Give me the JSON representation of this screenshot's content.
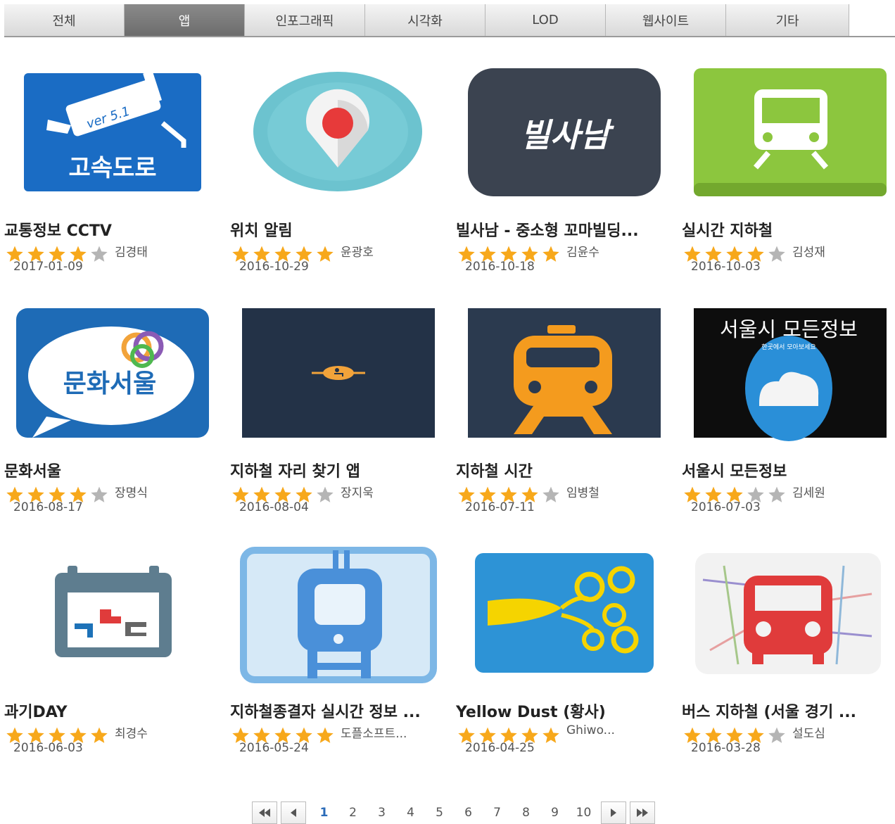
{
  "tabs": [
    "전체",
    "앱",
    "인포그래픽",
    "시각화",
    "LOD",
    "웹사이트",
    "기타"
  ],
  "active_tab": "앱",
  "icons": {
    "cctv": {
      "ver_text": "ver 5.1",
      "text": "고속도로"
    },
    "bilsanam": {
      "text": "빌사남"
    },
    "munhwa": {
      "text": "문화서울"
    },
    "seoul_info": {
      "title": "서울시 모든정보",
      "subtitle": "한곳에서 모아보세요"
    }
  },
  "apps": [
    {
      "title": "교통정보 CCTV",
      "author": "김경태",
      "date": "2017-01-09",
      "rating": 4,
      "icon": "cctv-icon"
    },
    {
      "title": "위치 알림",
      "author": "윤광호",
      "date": "2016-10-29",
      "rating": 5,
      "icon": "location-pin-icon"
    },
    {
      "title": "빌사남 - 중소형 꼬마빌딩...",
      "author": "김윤수",
      "date": "2016-10-18",
      "rating": 5,
      "icon": "bilsanam-logo-icon"
    },
    {
      "title": "실시간 지하철",
      "author": "김성재",
      "date": "2016-10-03",
      "rating": 4,
      "icon": "train-icon"
    },
    {
      "title": "문화서울",
      "author": "장명식",
      "date": "2016-08-17",
      "rating": 4,
      "icon": "culture-seoul-icon"
    },
    {
      "title": "지하철 자리 찾기 앱",
      "author": "장지욱",
      "date": "2016-08-04",
      "rating": 4,
      "icon": "seat-icon"
    },
    {
      "title": "지하철 시간",
      "author": "임병철",
      "date": "2016-07-11",
      "rating": 4,
      "icon": "orange-train-icon"
    },
    {
      "title": "서울시 모든정보",
      "author": "김세원",
      "date": "2016-07-03",
      "rating": 3,
      "icon": "cloud-info-icon"
    },
    {
      "title": "과기DAY",
      "author": "최경수",
      "date": "2016-06-03",
      "rating": 5,
      "icon": "calendar-icon"
    },
    {
      "title": "지하철종결자 실시간 정보 ...",
      "author": "도플소프트...",
      "date": "2016-05-24",
      "rating": 5,
      "icon": "subway-blue-icon"
    },
    {
      "title": "Yellow Dust (황사)",
      "author": "Ghiwo...",
      "date": "2016-04-25",
      "rating": 5,
      "icon": "wind-icon"
    },
    {
      "title": "버스 지하철 (서울 경기 ...",
      "author": "설도심",
      "date": "2016-03-28",
      "rating": 4,
      "icon": "bus-map-icon"
    }
  ],
  "pagination": {
    "pages": [
      "1",
      "2",
      "3",
      "4",
      "5",
      "6",
      "7",
      "8",
      "9",
      "10"
    ],
    "current": "1"
  },
  "colors": {
    "star_on": "#f7a81b",
    "star_off": "#b5b5b5",
    "tab_active": "#7a7a7a"
  }
}
